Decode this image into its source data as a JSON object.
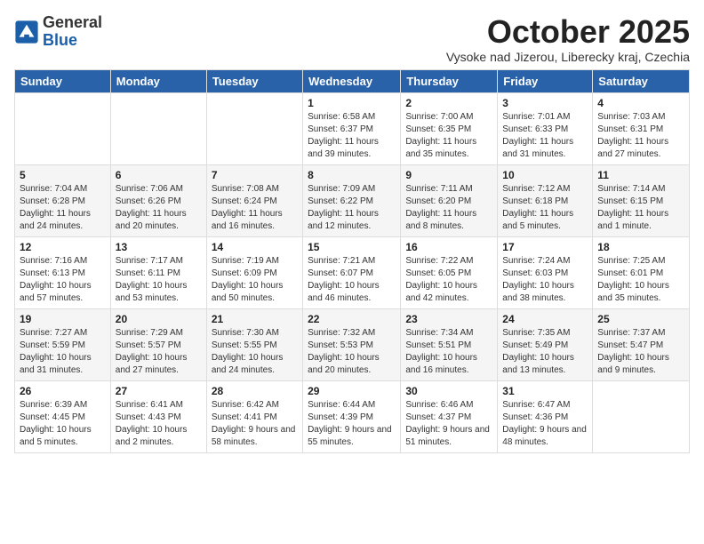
{
  "logo": {
    "general": "General",
    "blue": "Blue"
  },
  "title": "October 2025",
  "location": "Vysoke nad Jizerou, Liberecky kraj, Czechia",
  "headers": [
    "Sunday",
    "Monday",
    "Tuesday",
    "Wednesday",
    "Thursday",
    "Friday",
    "Saturday"
  ],
  "weeks": [
    [
      {
        "day": "",
        "sunrise": "",
        "sunset": "",
        "daylight": ""
      },
      {
        "day": "",
        "sunrise": "",
        "sunset": "",
        "daylight": ""
      },
      {
        "day": "",
        "sunrise": "",
        "sunset": "",
        "daylight": ""
      },
      {
        "day": "1",
        "sunrise": "Sunrise: 6:58 AM",
        "sunset": "Sunset: 6:37 PM",
        "daylight": "Daylight: 11 hours and 39 minutes."
      },
      {
        "day": "2",
        "sunrise": "Sunrise: 7:00 AM",
        "sunset": "Sunset: 6:35 PM",
        "daylight": "Daylight: 11 hours and 35 minutes."
      },
      {
        "day": "3",
        "sunrise": "Sunrise: 7:01 AM",
        "sunset": "Sunset: 6:33 PM",
        "daylight": "Daylight: 11 hours and 31 minutes."
      },
      {
        "day": "4",
        "sunrise": "Sunrise: 7:03 AM",
        "sunset": "Sunset: 6:31 PM",
        "daylight": "Daylight: 11 hours and 27 minutes."
      }
    ],
    [
      {
        "day": "5",
        "sunrise": "Sunrise: 7:04 AM",
        "sunset": "Sunset: 6:28 PM",
        "daylight": "Daylight: 11 hours and 24 minutes."
      },
      {
        "day": "6",
        "sunrise": "Sunrise: 7:06 AM",
        "sunset": "Sunset: 6:26 PM",
        "daylight": "Daylight: 11 hours and 20 minutes."
      },
      {
        "day": "7",
        "sunrise": "Sunrise: 7:08 AM",
        "sunset": "Sunset: 6:24 PM",
        "daylight": "Daylight: 11 hours and 16 minutes."
      },
      {
        "day": "8",
        "sunrise": "Sunrise: 7:09 AM",
        "sunset": "Sunset: 6:22 PM",
        "daylight": "Daylight: 11 hours and 12 minutes."
      },
      {
        "day": "9",
        "sunrise": "Sunrise: 7:11 AM",
        "sunset": "Sunset: 6:20 PM",
        "daylight": "Daylight: 11 hours and 8 minutes."
      },
      {
        "day": "10",
        "sunrise": "Sunrise: 7:12 AM",
        "sunset": "Sunset: 6:18 PM",
        "daylight": "Daylight: 11 hours and 5 minutes."
      },
      {
        "day": "11",
        "sunrise": "Sunrise: 7:14 AM",
        "sunset": "Sunset: 6:15 PM",
        "daylight": "Daylight: 11 hours and 1 minute."
      }
    ],
    [
      {
        "day": "12",
        "sunrise": "Sunrise: 7:16 AM",
        "sunset": "Sunset: 6:13 PM",
        "daylight": "Daylight: 10 hours and 57 minutes."
      },
      {
        "day": "13",
        "sunrise": "Sunrise: 7:17 AM",
        "sunset": "Sunset: 6:11 PM",
        "daylight": "Daylight: 10 hours and 53 minutes."
      },
      {
        "day": "14",
        "sunrise": "Sunrise: 7:19 AM",
        "sunset": "Sunset: 6:09 PM",
        "daylight": "Daylight: 10 hours and 50 minutes."
      },
      {
        "day": "15",
        "sunrise": "Sunrise: 7:21 AM",
        "sunset": "Sunset: 6:07 PM",
        "daylight": "Daylight: 10 hours and 46 minutes."
      },
      {
        "day": "16",
        "sunrise": "Sunrise: 7:22 AM",
        "sunset": "Sunset: 6:05 PM",
        "daylight": "Daylight: 10 hours and 42 minutes."
      },
      {
        "day": "17",
        "sunrise": "Sunrise: 7:24 AM",
        "sunset": "Sunset: 6:03 PM",
        "daylight": "Daylight: 10 hours and 38 minutes."
      },
      {
        "day": "18",
        "sunrise": "Sunrise: 7:25 AM",
        "sunset": "Sunset: 6:01 PM",
        "daylight": "Daylight: 10 hours and 35 minutes."
      }
    ],
    [
      {
        "day": "19",
        "sunrise": "Sunrise: 7:27 AM",
        "sunset": "Sunset: 5:59 PM",
        "daylight": "Daylight: 10 hours and 31 minutes."
      },
      {
        "day": "20",
        "sunrise": "Sunrise: 7:29 AM",
        "sunset": "Sunset: 5:57 PM",
        "daylight": "Daylight: 10 hours and 27 minutes."
      },
      {
        "day": "21",
        "sunrise": "Sunrise: 7:30 AM",
        "sunset": "Sunset: 5:55 PM",
        "daylight": "Daylight: 10 hours and 24 minutes."
      },
      {
        "day": "22",
        "sunrise": "Sunrise: 7:32 AM",
        "sunset": "Sunset: 5:53 PM",
        "daylight": "Daylight: 10 hours and 20 minutes."
      },
      {
        "day": "23",
        "sunrise": "Sunrise: 7:34 AM",
        "sunset": "Sunset: 5:51 PM",
        "daylight": "Daylight: 10 hours and 16 minutes."
      },
      {
        "day": "24",
        "sunrise": "Sunrise: 7:35 AM",
        "sunset": "Sunset: 5:49 PM",
        "daylight": "Daylight: 10 hours and 13 minutes."
      },
      {
        "day": "25",
        "sunrise": "Sunrise: 7:37 AM",
        "sunset": "Sunset: 5:47 PM",
        "daylight": "Daylight: 10 hours and 9 minutes."
      }
    ],
    [
      {
        "day": "26",
        "sunrise": "Sunrise: 6:39 AM",
        "sunset": "Sunset: 4:45 PM",
        "daylight": "Daylight: 10 hours and 5 minutes."
      },
      {
        "day": "27",
        "sunrise": "Sunrise: 6:41 AM",
        "sunset": "Sunset: 4:43 PM",
        "daylight": "Daylight: 10 hours and 2 minutes."
      },
      {
        "day": "28",
        "sunrise": "Sunrise: 6:42 AM",
        "sunset": "Sunset: 4:41 PM",
        "daylight": "Daylight: 9 hours and 58 minutes."
      },
      {
        "day": "29",
        "sunrise": "Sunrise: 6:44 AM",
        "sunset": "Sunset: 4:39 PM",
        "daylight": "Daylight: 9 hours and 55 minutes."
      },
      {
        "day": "30",
        "sunrise": "Sunrise: 6:46 AM",
        "sunset": "Sunset: 4:37 PM",
        "daylight": "Daylight: 9 hours and 51 minutes."
      },
      {
        "day": "31",
        "sunrise": "Sunrise: 6:47 AM",
        "sunset": "Sunset: 4:36 PM",
        "daylight": "Daylight: 9 hours and 48 minutes."
      },
      {
        "day": "",
        "sunrise": "",
        "sunset": "",
        "daylight": ""
      }
    ]
  ]
}
